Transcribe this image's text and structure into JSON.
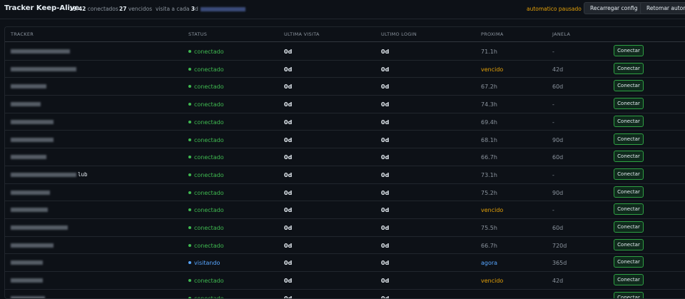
{
  "header": {
    "title": "Tracker Keep-Alive",
    "connected_count": "19",
    "total_count": "42",
    "connected_label": "conectados",
    "expired_count": "27",
    "expired_label": "vencidos",
    "interval_label": "visita a cada",
    "interval_value": "3",
    "interval_unit": "d",
    "auto_status": "automatico pausado",
    "reload_label": "Recarregar config",
    "resume_label": "Retomar automatico"
  },
  "colors": {
    "connected": "#3fb950",
    "visiting": "#58a6ff",
    "warning": "#e3a008",
    "background": "#0d1117"
  },
  "table": {
    "columns": [
      "TRACKER",
      "STATUS",
      "ULTIMA VISITA",
      "ULTIMO LOGIN",
      "PROXIMA",
      "JANELA"
    ],
    "action_label": "Conectar",
    "rows": [
      {
        "tracker": "",
        "status": "conectado",
        "last_visit": "0d",
        "last_login": "0d",
        "next": "71.1h",
        "window": "-"
      },
      {
        "tracker": "",
        "status": "conectado",
        "last_visit": "0d",
        "last_login": "0d",
        "next": "vencido",
        "window": "42d"
      },
      {
        "tracker": "",
        "status": "conectado",
        "last_visit": "0d",
        "last_login": "0d",
        "next": "67.2h",
        "window": "60d"
      },
      {
        "tracker": "",
        "status": "conectado",
        "last_visit": "0d",
        "last_login": "0d",
        "next": "74.3h",
        "window": "-"
      },
      {
        "tracker": "",
        "status": "conectado",
        "last_visit": "0d",
        "last_login": "0d",
        "next": "69.4h",
        "window": "-"
      },
      {
        "tracker": "",
        "status": "conectado",
        "last_visit": "0d",
        "last_login": "0d",
        "next": "68.1h",
        "window": "90d"
      },
      {
        "tracker": "",
        "status": "conectado",
        "last_visit": "0d",
        "last_login": "0d",
        "next": "66.7h",
        "window": "60d"
      },
      {
        "tracker": "lub",
        "status": "conectado",
        "last_visit": "0d",
        "last_login": "0d",
        "next": "73.1h",
        "window": "-"
      },
      {
        "tracker": "",
        "status": "conectado",
        "last_visit": "0d",
        "last_login": "0d",
        "next": "75.2h",
        "window": "90d"
      },
      {
        "tracker": "",
        "status": "conectado",
        "last_visit": "0d",
        "last_login": "0d",
        "next": "vencido",
        "window": "-"
      },
      {
        "tracker": "",
        "status": "conectado",
        "last_visit": "0d",
        "last_login": "0d",
        "next": "75.5h",
        "window": "60d"
      },
      {
        "tracker": "",
        "status": "conectado",
        "last_visit": "0d",
        "last_login": "0d",
        "next": "66.7h",
        "window": "720d"
      },
      {
        "tracker": "",
        "status": "visitando",
        "last_visit": "0d",
        "last_login": "0d",
        "next": "agora",
        "window": "365d"
      },
      {
        "tracker": "",
        "status": "conectado",
        "last_visit": "0d",
        "last_login": "0d",
        "next": "vencido",
        "window": "42d"
      },
      {
        "tracker": "",
        "status": "conectado",
        "last_visit": "0d",
        "last_login": "0d",
        "next": "",
        "window": ""
      }
    ]
  }
}
